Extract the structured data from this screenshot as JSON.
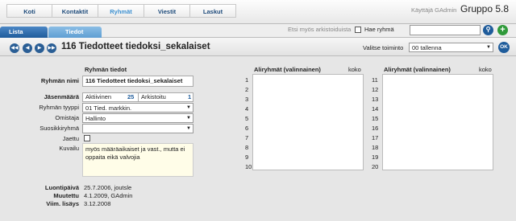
{
  "topnav": {
    "tabs": [
      {
        "label": "Koti"
      },
      {
        "label": "Kontaktit"
      },
      {
        "label": "Ryhmät"
      },
      {
        "label": "Viestit"
      },
      {
        "label": "Laskut"
      }
    ],
    "user": "Käyttäjä GAdmin",
    "app_name": "Gruppo 5.8"
  },
  "subbar": {
    "tabs": [
      {
        "label": "Lista"
      },
      {
        "label": "Tiedot"
      }
    ],
    "archived_label": "Etsi myös arkistoiduista",
    "search_label": "Hae ryhmä",
    "search_value": ""
  },
  "toolbar": {
    "group_title": "116 Tiedotteet tiedoksi_sekalaiset",
    "action_label": "Valitse toiminto",
    "action_value": "00 tallenna",
    "ok_label": "OK"
  },
  "details": {
    "header": "Ryhmän tiedot",
    "name_label": "Ryhmän nimi",
    "name_value": "116 Tiedotteet tiedoksi_sekalaiset",
    "members_label": "Jäsenmäärä",
    "active_label": "Aktiivinen",
    "active_value": "25",
    "archived_label": "Arkistoitu",
    "archived_value": "1",
    "type_label": "Ryhmän tyyppi",
    "type_value": "01 Tied. markkin.",
    "owner_label": "Omistaja",
    "owner_value": "Hallinto",
    "favorite_label": "Suosikkiryhmä",
    "favorite_value": "",
    "shared_label": "Jaettu",
    "description_label": "Kuvailu",
    "description_value": "myös määräaikaiset ja vast., mutta ei oppaita eikä valvojia"
  },
  "meta": {
    "created_label": "Luontipäivä",
    "created_value": "25.7.2006, joutsle",
    "modified_label": "Muutettu",
    "modified_value": "4.1.2009, GAdmin",
    "last_added_label": "Viim. lisäys",
    "last_added_value": "3.12.2008"
  },
  "subgroups": {
    "header": "Aliryhmät (valinnainen)",
    "koko_label": "koko",
    "left_numbers": [
      "1",
      "2",
      "3",
      "4",
      "5",
      "6",
      "7",
      "8",
      "9",
      "10"
    ],
    "right_numbers": [
      "11",
      "12",
      "13",
      "14",
      "15",
      "16",
      "17",
      "18",
      "19",
      "20"
    ]
  }
}
